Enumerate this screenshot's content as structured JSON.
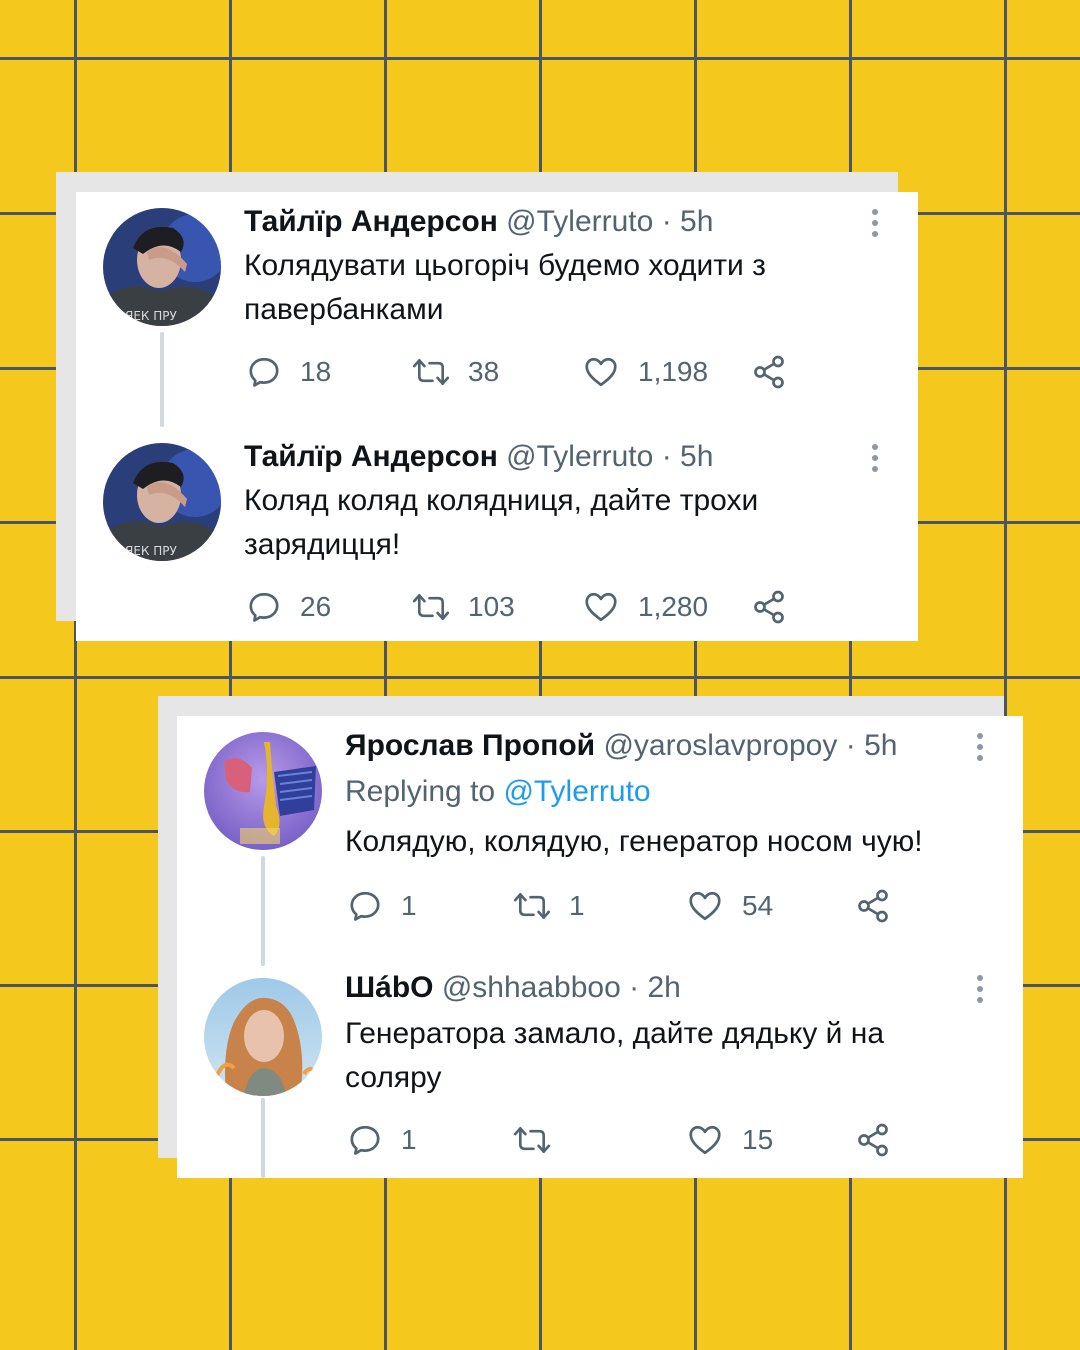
{
  "colors": {
    "background": "#f4c81c",
    "grid": "#4a5566",
    "card": "#ffffff",
    "text": "#0f1419",
    "muted": "#536471",
    "link": "#1d9bf0"
  },
  "thread1": {
    "tweets": [
      {
        "name": "Тайлїр Андерсон",
        "handle": "@Tylerruto",
        "separator": "·",
        "time": "5h",
        "text": "Колядувати цьогоріч будемо ходити з павербанками",
        "replies": "18",
        "retweets": "38",
        "likes": "1,198"
      },
      {
        "name": "Тайлїр Андерсон",
        "handle": "@Tylerruto",
        "separator": "·",
        "time": "5h",
        "text": "Коляд коляд колядниця, дайте трохи зарядицця!",
        "replies": "26",
        "retweets": "103",
        "likes": "1,280"
      }
    ]
  },
  "thread2": {
    "tweets": [
      {
        "name": "Ярослав Пропой",
        "handle": "@yaroslavpropoy",
        "separator": "·",
        "time": "5h",
        "replying_prefix": "Replying to",
        "replying_to": "@Tylerruto",
        "text": "Колядую, колядую, генератор носом чую!",
        "replies": "1",
        "retweets": "1",
        "likes": "54"
      },
      {
        "name": "ШábO",
        "handle": "@shhaabboo",
        "separator": "·",
        "time": "2h",
        "text": "Генератора замало, дайте дядьку й на соляру",
        "replies": "1",
        "retweets": "",
        "likes": "15"
      }
    ]
  }
}
